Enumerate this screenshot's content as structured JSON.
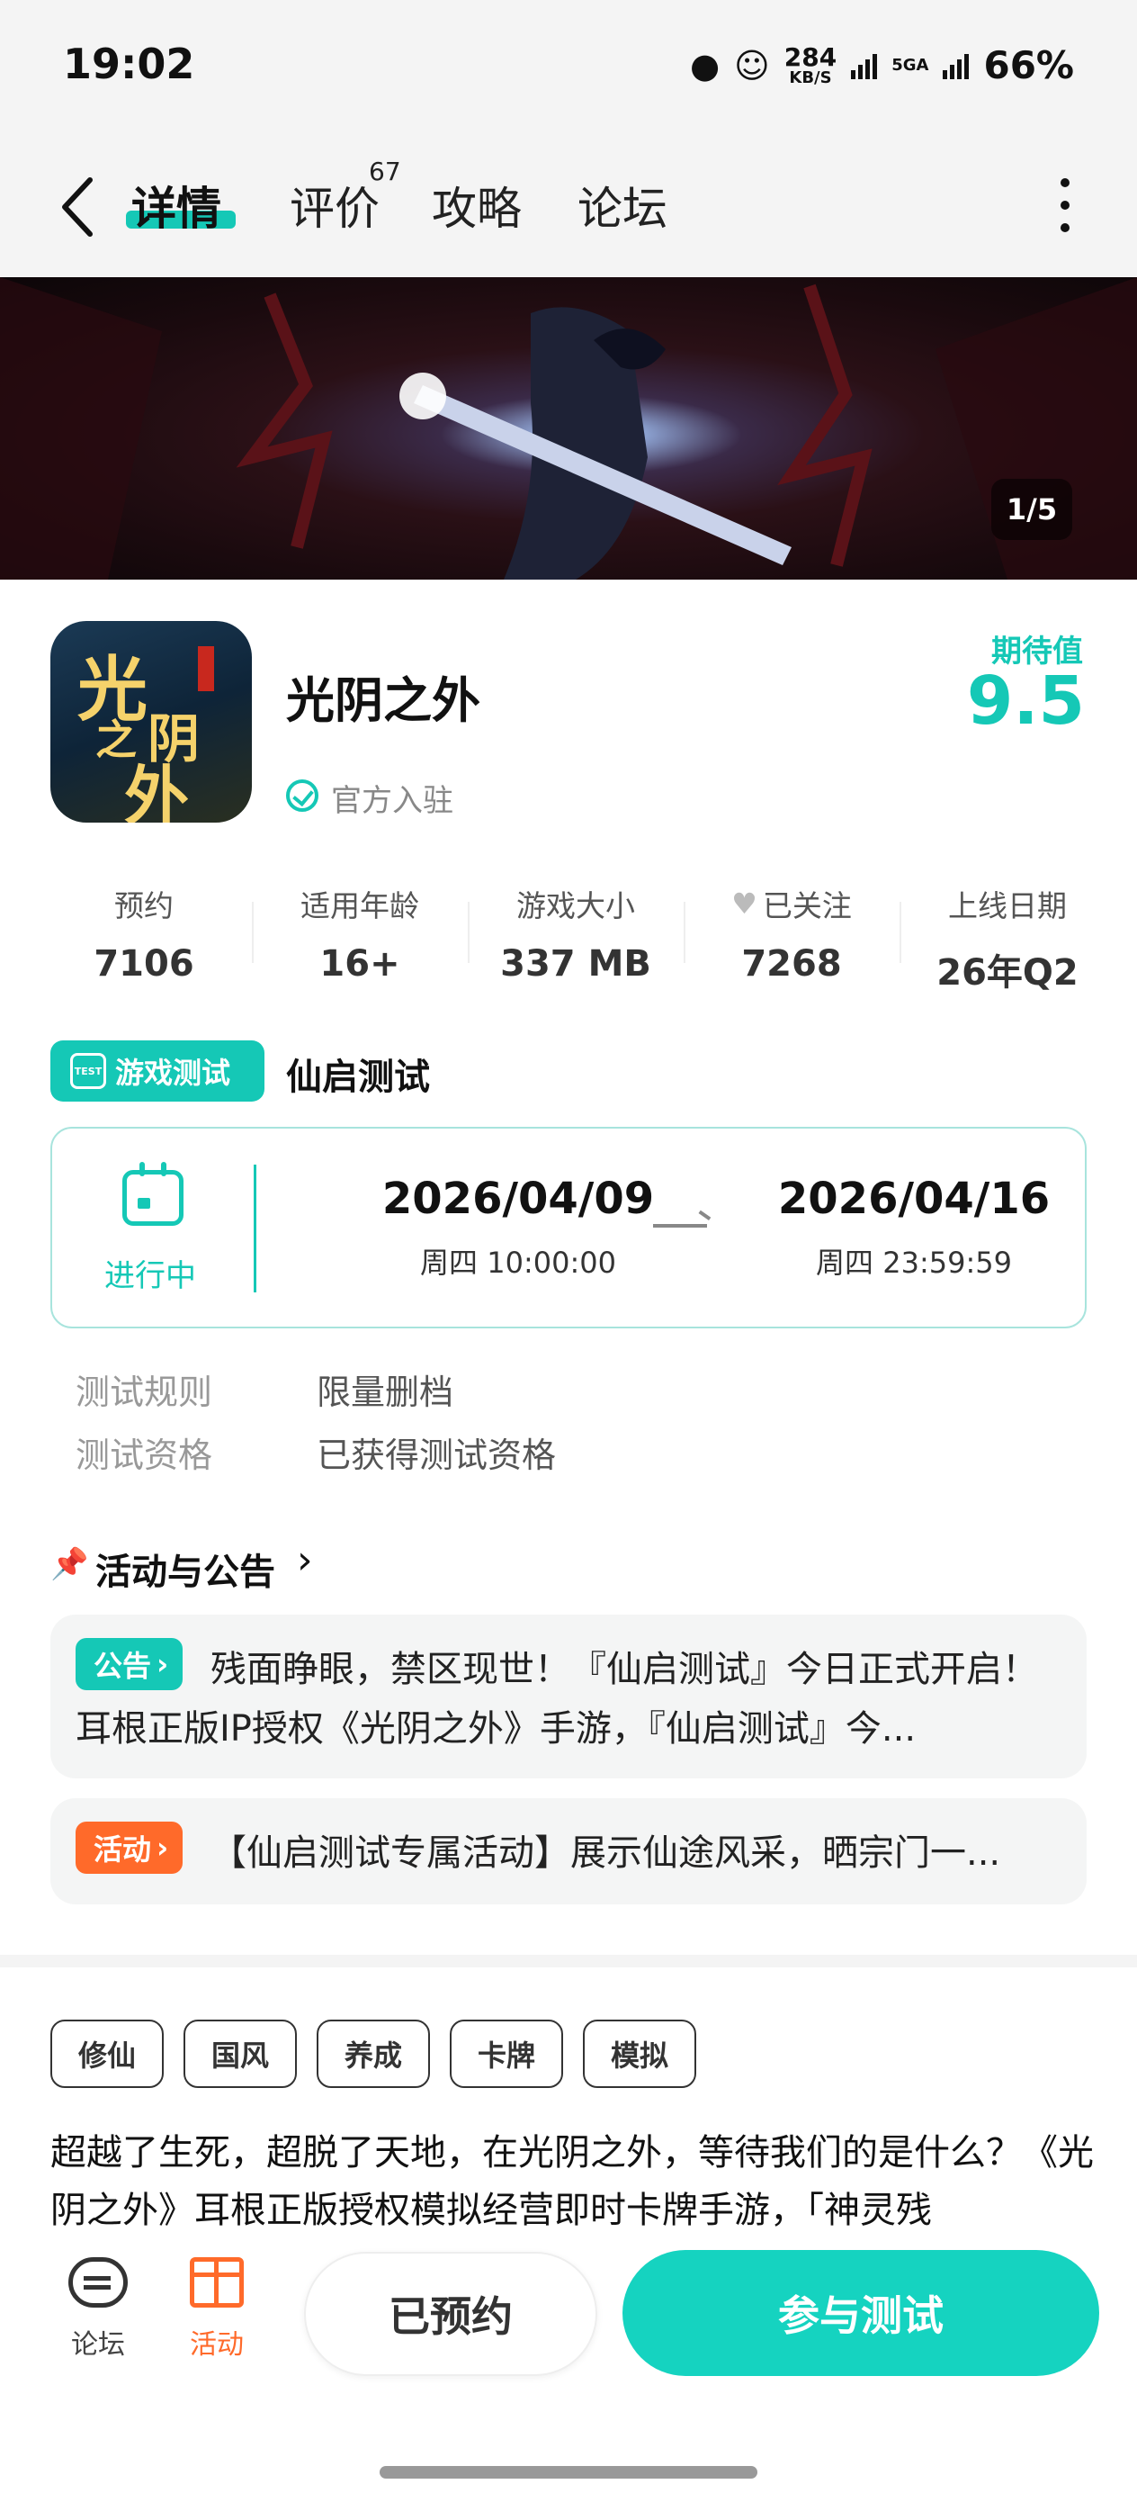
{
  "status_bar": {
    "time": "19:02",
    "net_speed": "284",
    "net_speed_unit": "KB/S",
    "sim2_label": "5GA",
    "battery": "66%"
  },
  "nav": {
    "tabs": [
      {
        "label": "详情",
        "active": true
      },
      {
        "label": "评价",
        "badge": "67"
      },
      {
        "label": "攻略"
      },
      {
        "label": "论坛"
      }
    ]
  },
  "banner": {
    "counter": "1/5"
  },
  "game": {
    "title": "光阴之外",
    "official_label": "官方入驻",
    "expectation_label": "期待值",
    "expectation_value": "9.5",
    "icon_glyphs": [
      "光",
      "之",
      "阴",
      "外"
    ]
  },
  "stats": [
    {
      "label": "预约",
      "value": "7106"
    },
    {
      "label": "适用年龄",
      "value": "16+"
    },
    {
      "label": "游戏大小",
      "value": "337 MB"
    },
    {
      "label": "已关注",
      "value": "7268"
    },
    {
      "label": "上线日期",
      "value": "26年Q2"
    }
  ],
  "test": {
    "badge_icon_text": "TEST",
    "badge_label": "游戏测试",
    "name": "仙启测试",
    "status": "进行中",
    "start_date": "2026/04/09",
    "start_time": "周四  10:00:00",
    "end_date": "2026/04/16",
    "end_time": "周四  23:59:59",
    "rules": [
      {
        "label": "测试规则",
        "value": "限量删档"
      },
      {
        "label": "测试资格",
        "value": "已获得测试资格"
      }
    ]
  },
  "activities": {
    "title": "活动与公告",
    "items": [
      {
        "tag": "公告",
        "tag_color": "#15c8b6",
        "text": "残面睁眼，禁区现世！『仙启测试』今日正式开启！ 耳根正版IP授权《光阴之外》手游，『仙启测试』今..."
      },
      {
        "tag": "活动",
        "tag_color": "#ff6a2a",
        "text": "【仙启测试专属活动】展示仙途风采，晒宗门一..."
      }
    ]
  },
  "tags": [
    "修仙",
    "国风",
    "养成",
    "卡牌",
    "模拟"
  ],
  "description": "超越了生死，超脱了天地，在光阴之外，等待我们的是什么？《光阴之外》耳根正版授权模拟经营即时卡牌手游，「神灵残",
  "bottom_bar": {
    "forum_label": "论坛",
    "activity_label": "活动",
    "reserved_label": "已预约",
    "join_label": "参与测试"
  },
  "colors": {
    "accent": "#15c8b6",
    "activity": "#ff6a2a"
  }
}
